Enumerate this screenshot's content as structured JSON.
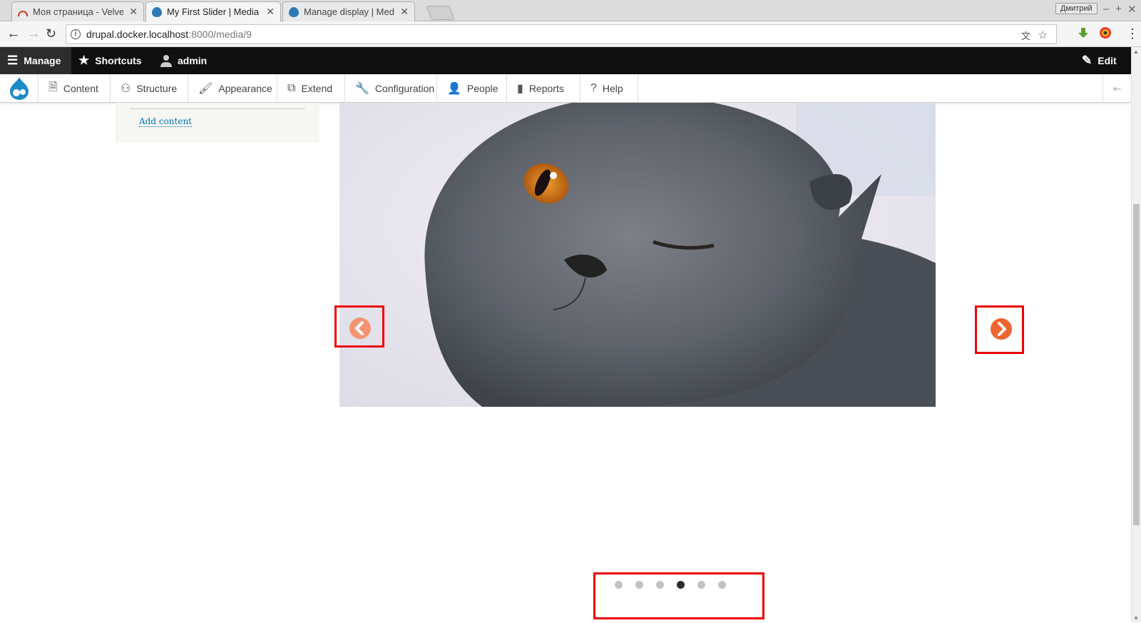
{
  "browser": {
    "tabs": [
      {
        "title": "Моя страница - Velvet",
        "favicon_color": "#d03a2c"
      },
      {
        "title": "My First Slider | Media",
        "favicon_color": "#2a7ab8"
      },
      {
        "title": "Manage display | Medi",
        "favicon_color": "#2a7ab8"
      }
    ],
    "user_badge": "Дмитрий",
    "url_host": "drupal.docker.localhost",
    "url_path": ":8000/media/9"
  },
  "admin_bar": {
    "manage": "Manage",
    "shortcuts": "Shortcuts",
    "user": "admin",
    "edit": "Edit"
  },
  "admin_menu": {
    "items": [
      {
        "label": "Content",
        "icon": "page-icon"
      },
      {
        "label": "Structure",
        "icon": "sitemap-icon"
      },
      {
        "label": "Appearance",
        "icon": "brush-icon"
      },
      {
        "label": "Extend",
        "icon": "puzzle-icon"
      },
      {
        "label": "Configuration",
        "icon": "wrench-icon"
      },
      {
        "label": "People",
        "icon": "people-icon"
      },
      {
        "label": "Reports",
        "icon": "bar-chart-icon"
      },
      {
        "label": "Help",
        "icon": "help-icon"
      }
    ]
  },
  "sidebar": {
    "add_content": "Add content"
  },
  "slider": {
    "slide_count": 6,
    "active_index": 3,
    "arrow_color": "#f0642d",
    "prev_arrow_color": "#f39575"
  }
}
